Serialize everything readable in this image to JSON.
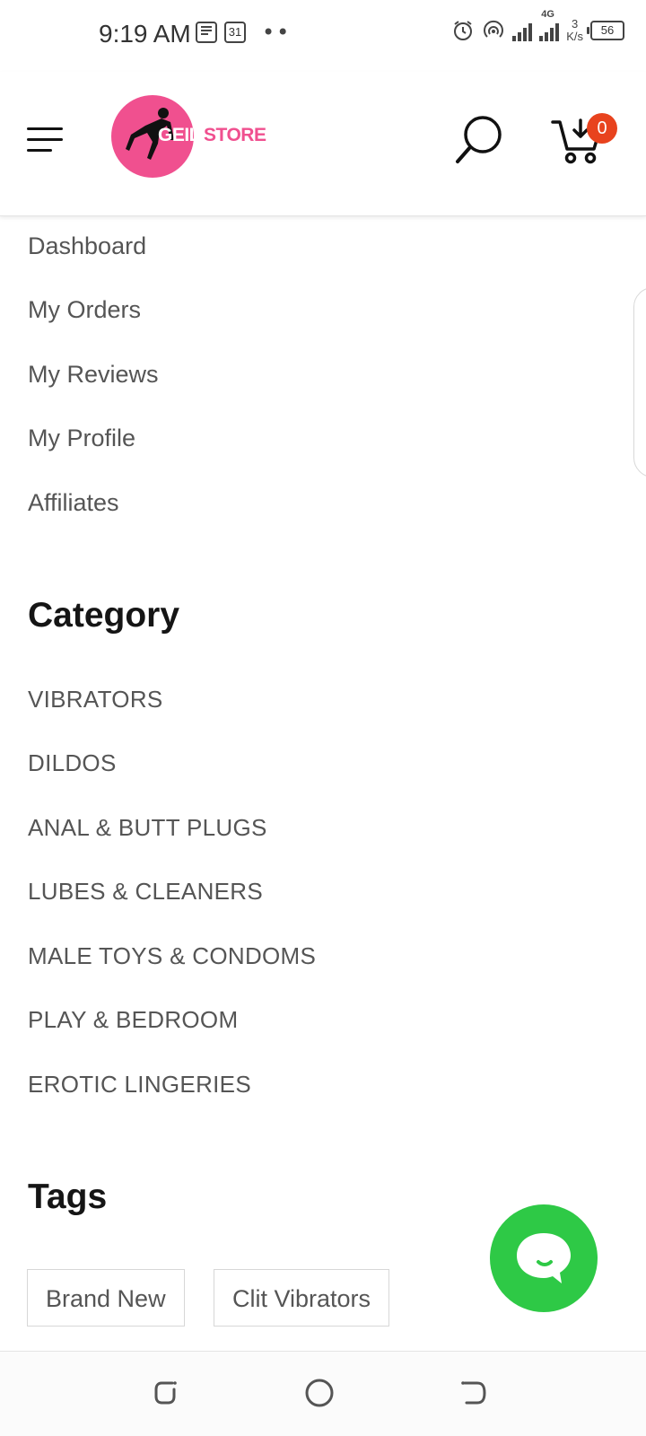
{
  "status_bar": {
    "time": "9:19 AM",
    "calendar_day": "31",
    "dots": "••",
    "net_speed_value": "3",
    "net_speed_unit": "K/s",
    "network_type": "4G",
    "battery": "56"
  },
  "header": {
    "logo_text_left": "GEIL",
    "logo_text_right": "STORE",
    "cart_count": "0"
  },
  "account_menu": {
    "items": [
      {
        "label": "Dashboard"
      },
      {
        "label": "My Orders"
      },
      {
        "label": "My Reviews"
      },
      {
        "label": "My Profile"
      },
      {
        "label": "Affiliates"
      }
    ]
  },
  "category": {
    "title": "Category",
    "items": [
      {
        "label": "VIBRATORS"
      },
      {
        "label": "DILDOS"
      },
      {
        "label": "ANAL & BUTT PLUGS"
      },
      {
        "label": "LUBES & CLEANERS"
      },
      {
        "label": "MALE TOYS & CONDOMS"
      },
      {
        "label": "PLAY & BEDROOM"
      },
      {
        "label": "EROTIC LINGERIES"
      }
    ]
  },
  "tags": {
    "title": "Tags",
    "items": [
      {
        "label": "Brand New"
      },
      {
        "label": "Clit Vibrators"
      }
    ]
  },
  "colors": {
    "brand_pink": "#f0508f",
    "badge_red": "#e8431e",
    "chat_green": "#2ec946"
  }
}
